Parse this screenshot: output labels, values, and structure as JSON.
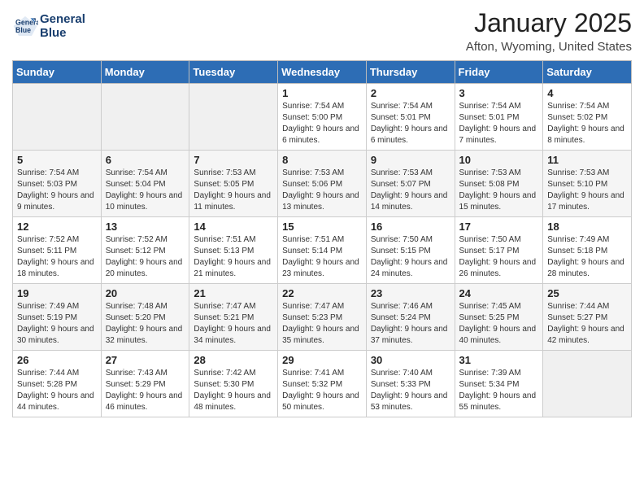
{
  "header": {
    "logo_line1": "General",
    "logo_line2": "Blue",
    "month_title": "January 2025",
    "location": "Afton, Wyoming, United States"
  },
  "weekdays": [
    "Sunday",
    "Monday",
    "Tuesday",
    "Wednesday",
    "Thursday",
    "Friday",
    "Saturday"
  ],
  "weeks": [
    [
      {
        "day": "",
        "sunrise": "",
        "sunset": "",
        "daylight": ""
      },
      {
        "day": "",
        "sunrise": "",
        "sunset": "",
        "daylight": ""
      },
      {
        "day": "",
        "sunrise": "",
        "sunset": "",
        "daylight": ""
      },
      {
        "day": "1",
        "sunrise": "Sunrise: 7:54 AM",
        "sunset": "Sunset: 5:00 PM",
        "daylight": "Daylight: 9 hours and 6 minutes."
      },
      {
        "day": "2",
        "sunrise": "Sunrise: 7:54 AM",
        "sunset": "Sunset: 5:01 PM",
        "daylight": "Daylight: 9 hours and 6 minutes."
      },
      {
        "day": "3",
        "sunrise": "Sunrise: 7:54 AM",
        "sunset": "Sunset: 5:01 PM",
        "daylight": "Daylight: 9 hours and 7 minutes."
      },
      {
        "day": "4",
        "sunrise": "Sunrise: 7:54 AM",
        "sunset": "Sunset: 5:02 PM",
        "daylight": "Daylight: 9 hours and 8 minutes."
      }
    ],
    [
      {
        "day": "5",
        "sunrise": "Sunrise: 7:54 AM",
        "sunset": "Sunset: 5:03 PM",
        "daylight": "Daylight: 9 hours and 9 minutes."
      },
      {
        "day": "6",
        "sunrise": "Sunrise: 7:54 AM",
        "sunset": "Sunset: 5:04 PM",
        "daylight": "Daylight: 9 hours and 10 minutes."
      },
      {
        "day": "7",
        "sunrise": "Sunrise: 7:53 AM",
        "sunset": "Sunset: 5:05 PM",
        "daylight": "Daylight: 9 hours and 11 minutes."
      },
      {
        "day": "8",
        "sunrise": "Sunrise: 7:53 AM",
        "sunset": "Sunset: 5:06 PM",
        "daylight": "Daylight: 9 hours and 13 minutes."
      },
      {
        "day": "9",
        "sunrise": "Sunrise: 7:53 AM",
        "sunset": "Sunset: 5:07 PM",
        "daylight": "Daylight: 9 hours and 14 minutes."
      },
      {
        "day": "10",
        "sunrise": "Sunrise: 7:53 AM",
        "sunset": "Sunset: 5:08 PM",
        "daylight": "Daylight: 9 hours and 15 minutes."
      },
      {
        "day": "11",
        "sunrise": "Sunrise: 7:53 AM",
        "sunset": "Sunset: 5:10 PM",
        "daylight": "Daylight: 9 hours and 17 minutes."
      }
    ],
    [
      {
        "day": "12",
        "sunrise": "Sunrise: 7:52 AM",
        "sunset": "Sunset: 5:11 PM",
        "daylight": "Daylight: 9 hours and 18 minutes."
      },
      {
        "day": "13",
        "sunrise": "Sunrise: 7:52 AM",
        "sunset": "Sunset: 5:12 PM",
        "daylight": "Daylight: 9 hours and 20 minutes."
      },
      {
        "day": "14",
        "sunrise": "Sunrise: 7:51 AM",
        "sunset": "Sunset: 5:13 PM",
        "daylight": "Daylight: 9 hours and 21 minutes."
      },
      {
        "day": "15",
        "sunrise": "Sunrise: 7:51 AM",
        "sunset": "Sunset: 5:14 PM",
        "daylight": "Daylight: 9 hours and 23 minutes."
      },
      {
        "day": "16",
        "sunrise": "Sunrise: 7:50 AM",
        "sunset": "Sunset: 5:15 PM",
        "daylight": "Daylight: 9 hours and 24 minutes."
      },
      {
        "day": "17",
        "sunrise": "Sunrise: 7:50 AM",
        "sunset": "Sunset: 5:17 PM",
        "daylight": "Daylight: 9 hours and 26 minutes."
      },
      {
        "day": "18",
        "sunrise": "Sunrise: 7:49 AM",
        "sunset": "Sunset: 5:18 PM",
        "daylight": "Daylight: 9 hours and 28 minutes."
      }
    ],
    [
      {
        "day": "19",
        "sunrise": "Sunrise: 7:49 AM",
        "sunset": "Sunset: 5:19 PM",
        "daylight": "Daylight: 9 hours and 30 minutes."
      },
      {
        "day": "20",
        "sunrise": "Sunrise: 7:48 AM",
        "sunset": "Sunset: 5:20 PM",
        "daylight": "Daylight: 9 hours and 32 minutes."
      },
      {
        "day": "21",
        "sunrise": "Sunrise: 7:47 AM",
        "sunset": "Sunset: 5:21 PM",
        "daylight": "Daylight: 9 hours and 34 minutes."
      },
      {
        "day": "22",
        "sunrise": "Sunrise: 7:47 AM",
        "sunset": "Sunset: 5:23 PM",
        "daylight": "Daylight: 9 hours and 35 minutes."
      },
      {
        "day": "23",
        "sunrise": "Sunrise: 7:46 AM",
        "sunset": "Sunset: 5:24 PM",
        "daylight": "Daylight: 9 hours and 37 minutes."
      },
      {
        "day": "24",
        "sunrise": "Sunrise: 7:45 AM",
        "sunset": "Sunset: 5:25 PM",
        "daylight": "Daylight: 9 hours and 40 minutes."
      },
      {
        "day": "25",
        "sunrise": "Sunrise: 7:44 AM",
        "sunset": "Sunset: 5:27 PM",
        "daylight": "Daylight: 9 hours and 42 minutes."
      }
    ],
    [
      {
        "day": "26",
        "sunrise": "Sunrise: 7:44 AM",
        "sunset": "Sunset: 5:28 PM",
        "daylight": "Daylight: 9 hours and 44 minutes."
      },
      {
        "day": "27",
        "sunrise": "Sunrise: 7:43 AM",
        "sunset": "Sunset: 5:29 PM",
        "daylight": "Daylight: 9 hours and 46 minutes."
      },
      {
        "day": "28",
        "sunrise": "Sunrise: 7:42 AM",
        "sunset": "Sunset: 5:30 PM",
        "daylight": "Daylight: 9 hours and 48 minutes."
      },
      {
        "day": "29",
        "sunrise": "Sunrise: 7:41 AM",
        "sunset": "Sunset: 5:32 PM",
        "daylight": "Daylight: 9 hours and 50 minutes."
      },
      {
        "day": "30",
        "sunrise": "Sunrise: 7:40 AM",
        "sunset": "Sunset: 5:33 PM",
        "daylight": "Daylight: 9 hours and 53 minutes."
      },
      {
        "day": "31",
        "sunrise": "Sunrise: 7:39 AM",
        "sunset": "Sunset: 5:34 PM",
        "daylight": "Daylight: 9 hours and 55 minutes."
      },
      {
        "day": "",
        "sunrise": "",
        "sunset": "",
        "daylight": ""
      }
    ]
  ]
}
